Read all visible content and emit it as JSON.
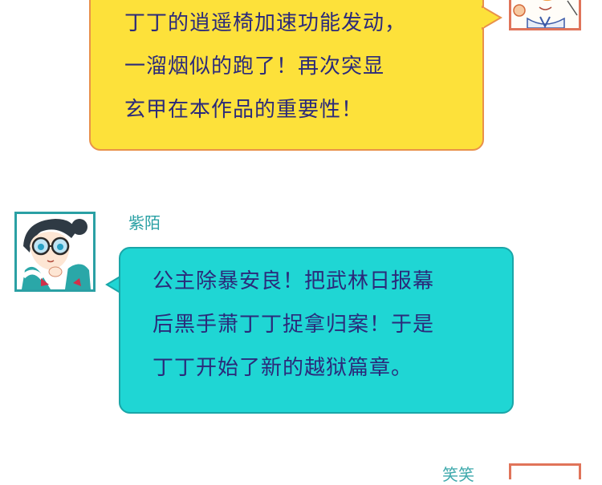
{
  "panels": [
    {
      "speaker": "",
      "lines": [
        "丁丁的逍遥椅加速功能发动，",
        "一溜烟似的跑了！再次突显",
        "玄甲在本作品的重要性！"
      ],
      "bubble_color": "#fde13a",
      "border_color": "#e9914a"
    },
    {
      "speaker": "紫陌",
      "lines": [
        "公主除暴安良！把武林日报幕",
        "后黑手萧丁丁捉拿归案！于是",
        "丁丁开始了新的越狱篇章。"
      ],
      "bubble_color": "#1fd6d4",
      "border_color": "#1aa6a8"
    }
  ],
  "next_speaker_partial": "笑笑",
  "colors": {
    "text": "#2b2a7a",
    "name": "#2aa0a4",
    "avatar_border_orange": "#e0745a",
    "avatar_border_teal": "#2aa0a4"
  }
}
